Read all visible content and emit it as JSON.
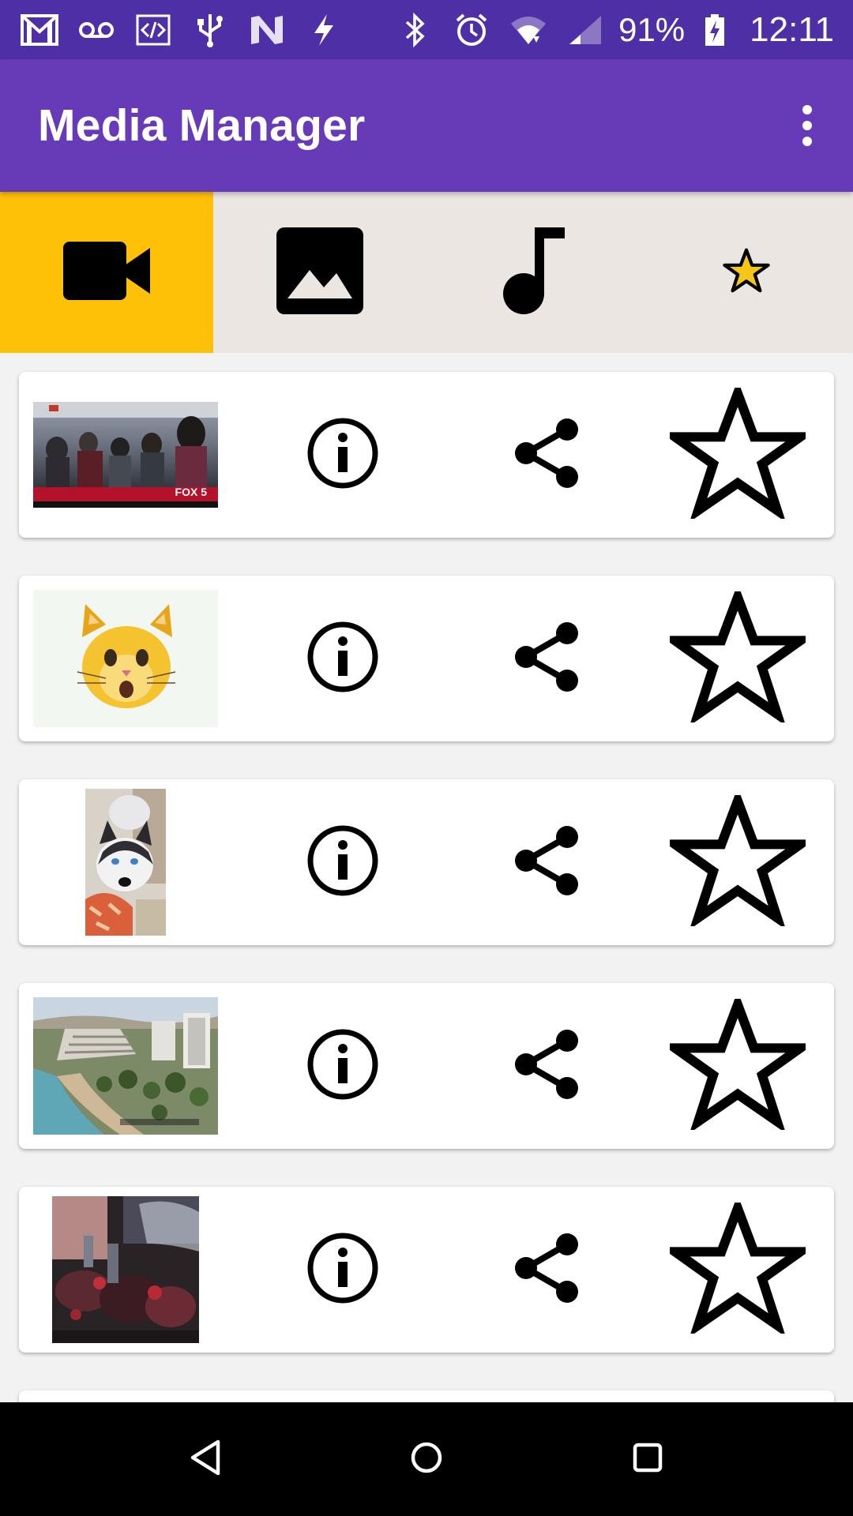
{
  "status_bar": {
    "left_icons": [
      "gmail-icon",
      "voicemail-icon",
      "code-icon",
      "usb-icon",
      "n-app-icon",
      "flash-icon"
    ],
    "right_icons": [
      "bluetooth-icon",
      "alarm-icon",
      "wifi-icon",
      "signal-icon"
    ],
    "battery_percent": "91%",
    "time": "12:11"
  },
  "app_bar": {
    "title": "Media Manager",
    "menu_icon": "more-vert-icon"
  },
  "tabs": [
    {
      "id": "videos",
      "icon": "videocam-icon",
      "active": true
    },
    {
      "id": "images",
      "icon": "image-icon",
      "active": false
    },
    {
      "id": "music",
      "icon": "music-note-icon",
      "active": false
    },
    {
      "id": "favorites",
      "icon": "star-icon",
      "active": false
    }
  ],
  "media_items": [
    {
      "thumbnail": "news-crowd-thumbnail",
      "thumb_text": "FOX 5",
      "favorite": false
    },
    {
      "thumbnail": "cat-emoji-thumbnail",
      "favorite": false
    },
    {
      "thumbnail": "husky-dog-thumbnail",
      "favorite": false
    },
    {
      "thumbnail": "beach-city-thumbnail",
      "favorite": false
    },
    {
      "thumbnail": "dark-scene-thumbnail",
      "favorite": false
    }
  ],
  "nav_bar": {
    "buttons": [
      "back-icon",
      "home-icon",
      "recents-icon"
    ]
  },
  "colors": {
    "status_bar": "#4f2fa6",
    "app_bar": "#673ab7",
    "tab_active": "#ffc107",
    "tab_bg": "#ebe6e1",
    "star_fill": "#f5c518",
    "list_bg": "#f2f2f2"
  }
}
